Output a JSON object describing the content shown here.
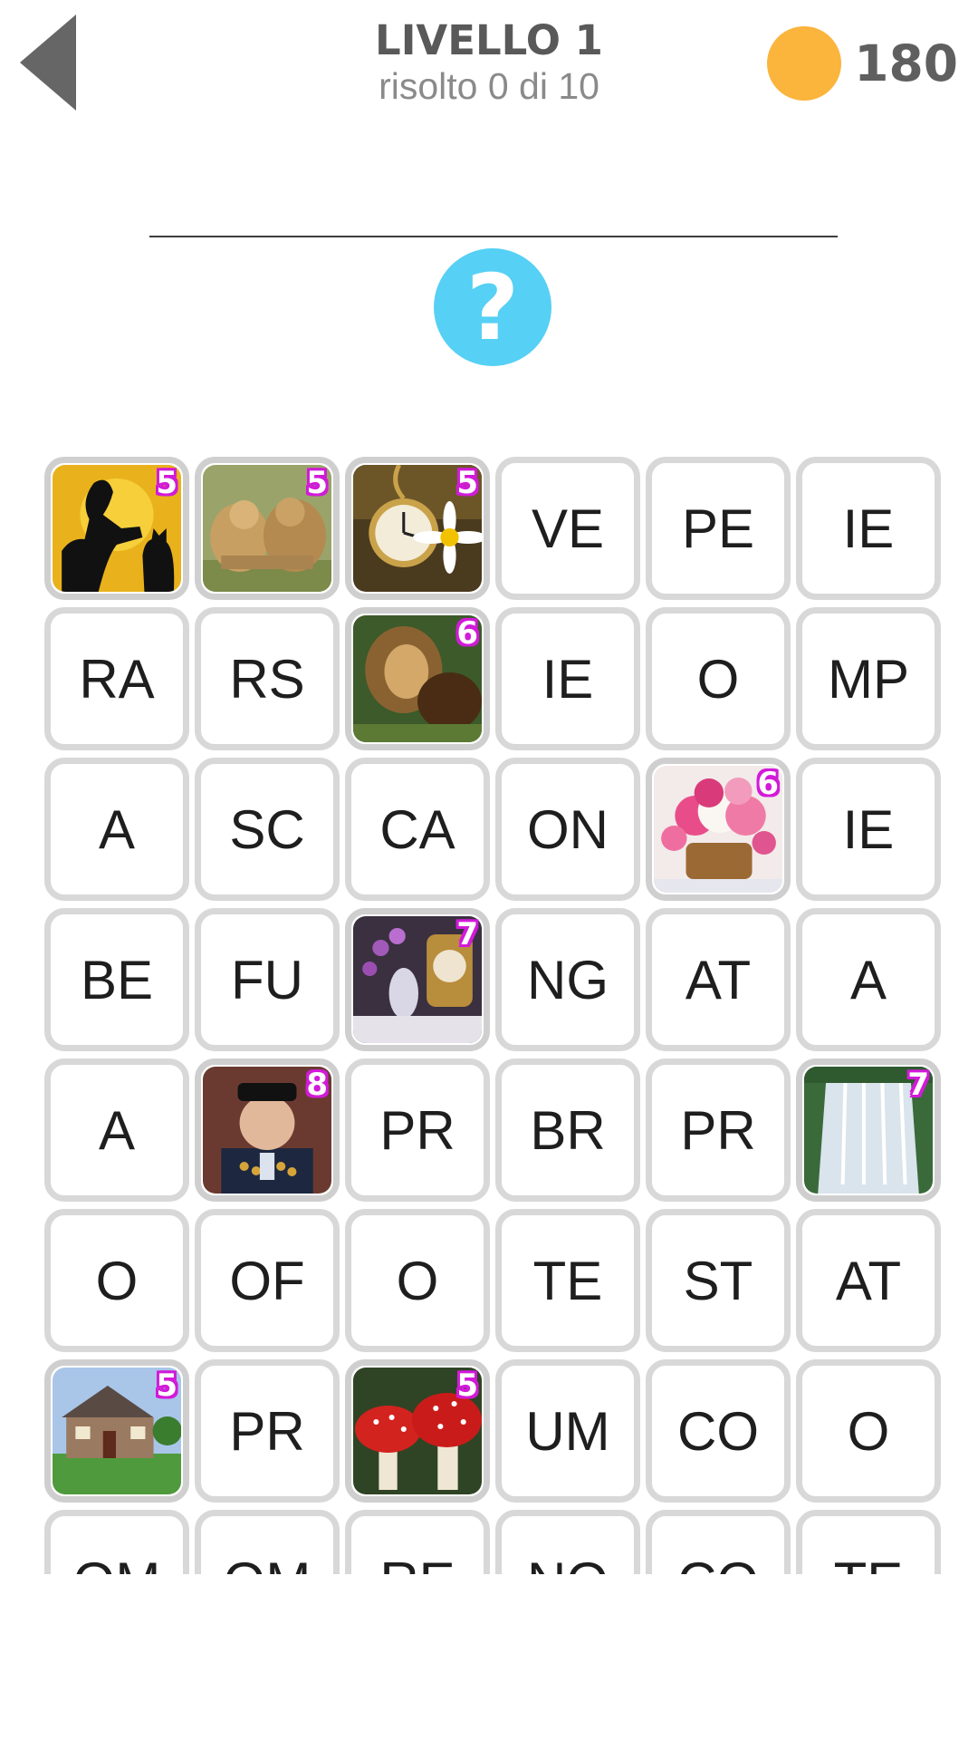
{
  "header": {
    "title": "LIVELLO 1",
    "progress": "risolto 0 di 10",
    "coins": "180",
    "back_icon": "back-arrow-icon",
    "coin_icon": "coin-icon",
    "hint_symbol": "?"
  },
  "colors": {
    "coin": "#fbb43c",
    "hint": "#56d0f5",
    "badge": "#d21ad9",
    "tile_border": "#d8d8d8"
  },
  "tiles": [
    {
      "type": "image",
      "name": "silhouette-woman-cat-image",
      "badge": "5"
    },
    {
      "type": "image",
      "name": "lions-fighting-image",
      "badge": "5"
    },
    {
      "type": "image",
      "name": "pocket-watch-daisy-image",
      "badge": "5"
    },
    {
      "type": "text",
      "text": "VE"
    },
    {
      "type": "text",
      "text": "PE"
    },
    {
      "type": "text",
      "text": "IE"
    },
    {
      "type": "text",
      "text": "RA"
    },
    {
      "type": "text",
      "text": "RS"
    },
    {
      "type": "image",
      "name": "lion-and-bear-image",
      "badge": "6"
    },
    {
      "type": "text",
      "text": "IE"
    },
    {
      "type": "text",
      "text": "O"
    },
    {
      "type": "text",
      "text": "MP"
    },
    {
      "type": "text",
      "text": "A"
    },
    {
      "type": "text",
      "text": "SC"
    },
    {
      "type": "text",
      "text": "CA"
    },
    {
      "type": "text",
      "text": "ON"
    },
    {
      "type": "image",
      "name": "peony-basket-image",
      "badge": "6"
    },
    {
      "type": "text",
      "text": "IE"
    },
    {
      "type": "text",
      "text": "BE"
    },
    {
      "type": "text",
      "text": "FU"
    },
    {
      "type": "image",
      "name": "clock-orchid-still-life-image",
      "badge": "7"
    },
    {
      "type": "text",
      "text": "NG"
    },
    {
      "type": "text",
      "text": "AT"
    },
    {
      "type": "text",
      "text": "A"
    },
    {
      "type": "text",
      "text": "A"
    },
    {
      "type": "image",
      "name": "veteran-sailor-image",
      "badge": "8"
    },
    {
      "type": "text",
      "text": "PR"
    },
    {
      "type": "text",
      "text": "BR"
    },
    {
      "type": "text",
      "text": "PR"
    },
    {
      "type": "image",
      "name": "waterfall-image",
      "badge": "7"
    },
    {
      "type": "text",
      "text": "O"
    },
    {
      "type": "text",
      "text": "OF"
    },
    {
      "type": "text",
      "text": "O"
    },
    {
      "type": "text",
      "text": "TE"
    },
    {
      "type": "text",
      "text": "ST"
    },
    {
      "type": "text",
      "text": "AT"
    },
    {
      "type": "image",
      "name": "house-image",
      "badge": "5"
    },
    {
      "type": "text",
      "text": "PR"
    },
    {
      "type": "image",
      "name": "red-mushrooms-image",
      "badge": "5"
    },
    {
      "type": "text",
      "text": "UM"
    },
    {
      "type": "text",
      "text": "CO"
    },
    {
      "type": "text",
      "text": "O"
    },
    {
      "type": "text",
      "text": "OM"
    },
    {
      "type": "text",
      "text": "OM"
    },
    {
      "type": "text",
      "text": "RE"
    },
    {
      "type": "text",
      "text": "NO"
    },
    {
      "type": "text",
      "text": "CO"
    },
    {
      "type": "text",
      "text": "TE"
    }
  ]
}
